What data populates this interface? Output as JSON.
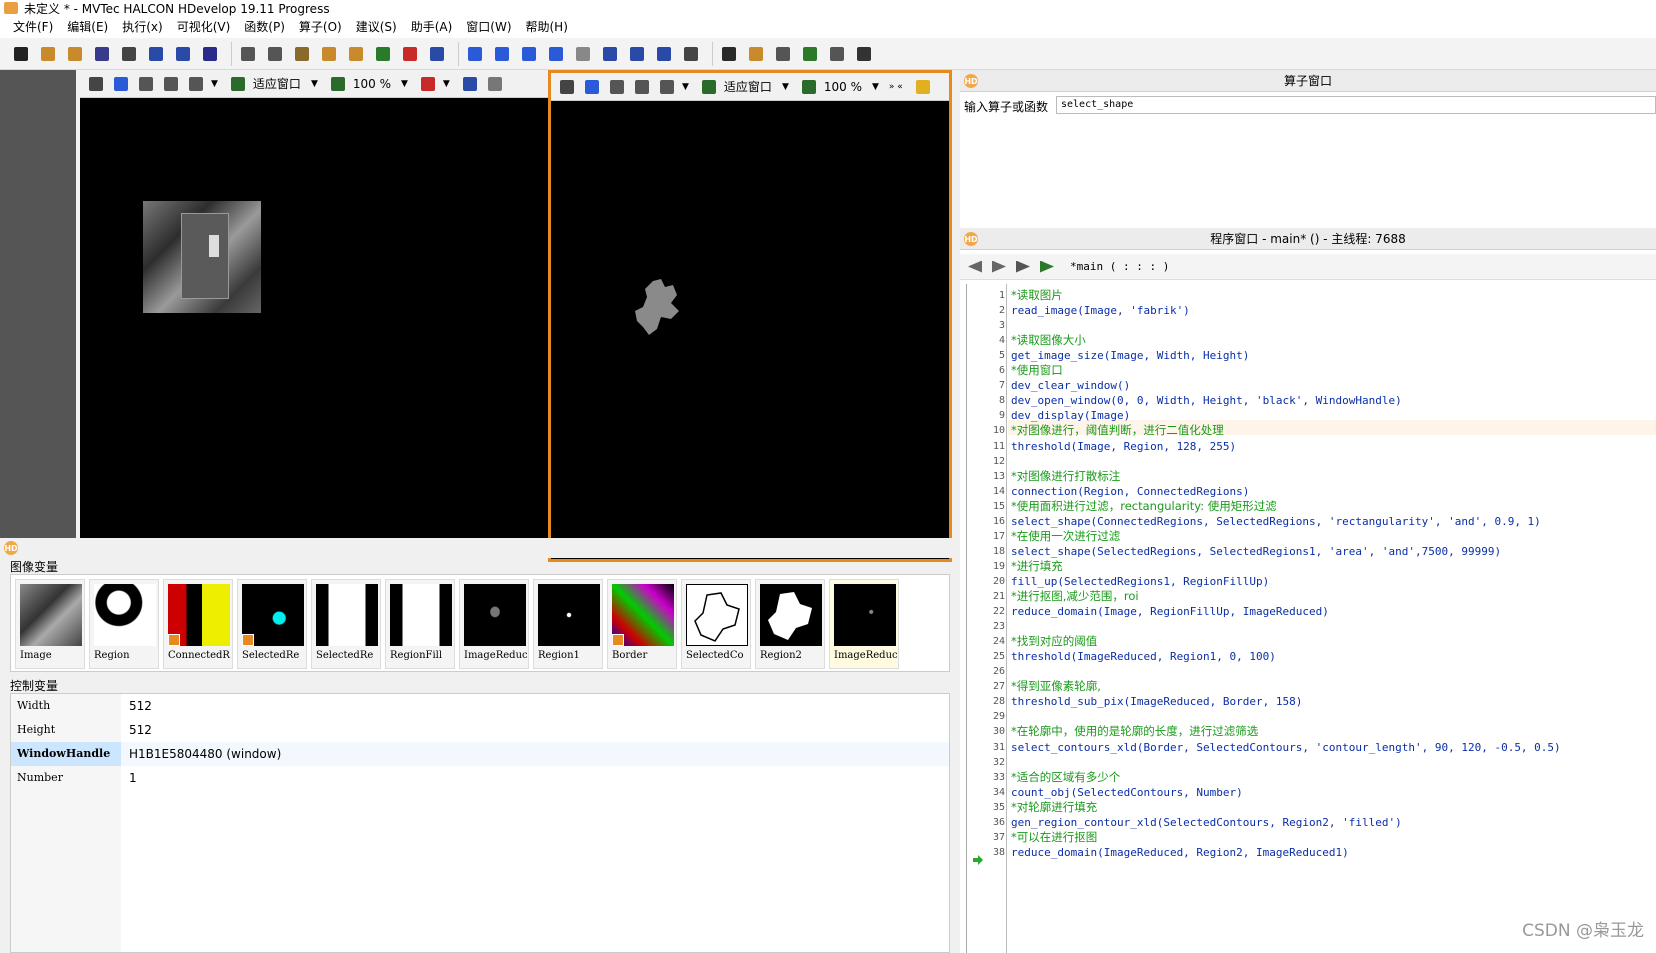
{
  "window": {
    "title": "未定义 * - MVTec HALCON HDevelop 19.11 Progress"
  },
  "menu": [
    "文件(F)",
    "编辑(E)",
    "执行(x)",
    "可视化(V)",
    "函数(P)",
    "算子(O)",
    "建议(S)",
    "助手(A)",
    "窗口(W)",
    "帮助(H)"
  ],
  "graphics1": {
    "fit_label": "适应窗口",
    "zoom": "100 %"
  },
  "graphics2": {
    "fit_label": "适应窗口",
    "zoom": "100 %"
  },
  "variables": {
    "image_section": "图像变量",
    "image_vars": [
      "Image",
      "Region",
      "ConnectedR",
      "SelectedRe",
      "SelectedRe",
      "RegionFill",
      "ImageReduc",
      "Region1",
      "Border",
      "SelectedCo",
      "Region2",
      "ImageReduc"
    ],
    "control_section": "控制变量",
    "control_vars": [
      {
        "name": "Width",
        "value": "512"
      },
      {
        "name": "Height",
        "value": "512"
      },
      {
        "name": "WindowHandle",
        "value": "H1B1E5804480 (window)"
      },
      {
        "name": "Number",
        "value": "1"
      }
    ]
  },
  "operator_window": {
    "title": "算子窗口",
    "label": "输入算子或函数",
    "value": "select_shape"
  },
  "program_window": {
    "title": "程序窗口 - main* () - 主线程: 7688",
    "procedure": "*main ( : : : )"
  },
  "code": [
    {
      "n": "1",
      "t": "*读取图片",
      "c": true
    },
    {
      "n": "2",
      "t": "read_image(Image, 'fabrik')",
      "c": false
    },
    {
      "n": "3",
      "t": "",
      "c": false
    },
    {
      "n": "4",
      "t": "*读取图像大小",
      "c": true
    },
    {
      "n": "5",
      "t": "get_image_size(Image, Width, Height)",
      "c": false
    },
    {
      "n": "6",
      "t": "*使用窗口",
      "c": true
    },
    {
      "n": "7",
      "t": "dev_clear_window()",
      "c": false
    },
    {
      "n": "8",
      "t": "dev_open_window(0, 0, Width, Height, 'black', WindowHandle)",
      "c": false
    },
    {
      "n": "9",
      "t": "dev_display(Image)",
      "c": false
    },
    {
      "n": "10",
      "t": "*对图像进行，阈值判断，进行二值化处理",
      "c": true
    },
    {
      "n": "11",
      "t": "threshold(Image, Region, 128, 255)",
      "c": false
    },
    {
      "n": "12",
      "t": "",
      "c": false
    },
    {
      "n": "13",
      "t": "*对图像进行打散标注",
      "c": true
    },
    {
      "n": "14",
      "t": "connection(Region, ConnectedRegions)",
      "c": false
    },
    {
      "n": "15",
      "t": "*使用面积进行过滤，rectangularity: 使用矩形过滤",
      "c": true
    },
    {
      "n": "16",
      "t": "select_shape(ConnectedRegions, SelectedRegions, 'rectangularity', 'and', 0.9, 1)",
      "c": false
    },
    {
      "n": "17",
      "t": "*在使用一次进行过滤",
      "c": true
    },
    {
      "n": "18",
      "t": "select_shape(SelectedRegions, SelectedRegions1, 'area', 'and',7500, 99999)",
      "c": false
    },
    {
      "n": "19",
      "t": "*进行填充",
      "c": true
    },
    {
      "n": "20",
      "t": "fill_up(SelectedRegions1, RegionFillUp)",
      "c": false
    },
    {
      "n": "21",
      "t": "*进行抠图,减少范围，roi",
      "c": true
    },
    {
      "n": "22",
      "t": "reduce_domain(Image, RegionFillUp, ImageReduced)",
      "c": false
    },
    {
      "n": "23",
      "t": "",
      "c": false
    },
    {
      "n": "24",
      "t": "*找到对应的阈值",
      "c": true
    },
    {
      "n": "25",
      "t": "threshold(ImageReduced, Region1, 0, 100)",
      "c": false
    },
    {
      "n": "26",
      "t": "",
      "c": false
    },
    {
      "n": "27",
      "t": "*得到亚像素轮廓,",
      "c": true
    },
    {
      "n": "28",
      "t": "threshold_sub_pix(ImageReduced, Border, 158)",
      "c": false
    },
    {
      "n": "29",
      "t": "",
      "c": false
    },
    {
      "n": "30",
      "t": "*在轮廓中，使用的是轮廓的长度，进行过滤筛选",
      "c": true
    },
    {
      "n": "31",
      "t": "select_contours_xld(Border, SelectedContours, 'contour_length', 90, 120, -0.5, 0.5)",
      "c": false
    },
    {
      "n": "32",
      "t": "",
      "c": false
    },
    {
      "n": "33",
      "t": "*适合的区域有多少个",
      "c": true
    },
    {
      "n": "34",
      "t": "count_obj(SelectedContours, Number)",
      "c": false
    },
    {
      "n": "35",
      "t": "*对轮廓进行填充",
      "c": true
    },
    {
      "n": "36",
      "t": "gen_region_contour_xld(SelectedContours, Region2, 'filled')",
      "c": false
    },
    {
      "n": "37",
      "t": "*可以在进行抠图",
      "c": true
    },
    {
      "n": "38",
      "t": "reduce_domain(ImageReduced, Region2, ImageReduced1)",
      "c": false
    }
  ],
  "watermark": "CSDN @枭玉龙",
  "colors": {
    "accent": "#e6891e",
    "comment": "#1a9a1a",
    "code": "#0a2ea8"
  }
}
